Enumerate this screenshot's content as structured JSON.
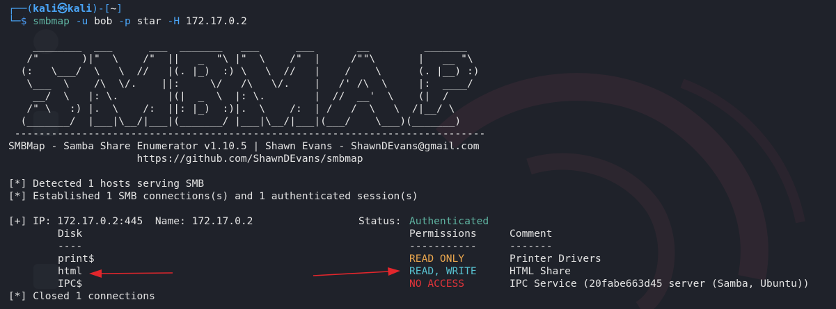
{
  "prompt": {
    "open": "┌──(",
    "user": "kali",
    "at": "㉿",
    "host": "kali",
    "close": ")-[",
    "dir": "~",
    "end": "]",
    "second": "└─",
    "dollar": "$",
    "command": "smbmap",
    "args": [
      {
        "flag": "-u",
        "value": "bob"
      },
      {
        "flag": "-p",
        "value": "star"
      },
      {
        "flag": "-H",
        "value": "172.17.0.2"
      }
    ]
  },
  "banner_lines": [
    "    ________  ___      ___  _______   ___      ___       __         _______",
    "   /\"       )|\"  \\    /\"  ||   _  \"\\ |\"  \\    /\"  |     /\"\"\\       |   __ \"\\",
    "  (:   \\___/  \\   \\  //   |(. |_)  :) \\   \\  //   |    /    \\      (. |__) :)",
    "   \\___  \\    /\\  \\/.    ||:     \\/   /\\   \\/.    |   /' /\\  \\     |:  ____/",
    "    __/  \\   |: \\.        |(|  _  \\  |: \\.        |  //  __'  \\    (|  /",
    "   /\" \\   :) |.  \\    /:  ||: |_)  :)|.  \\    /:  | /   /  \\   \\  /|__/ \\",
    "  (_______/  |___|\\__/|___|(_______/ |___|\\__/|___|(___/    \\___)(_______)",
    " -----------------------------------------------------------------------------"
  ],
  "header": {
    "title": "SMBMap - Samba Share Enumerator v1.10.5 | Shawn Evans - ShawnDEvans@gmail.com",
    "url": "                     https://github.com/ShawnDEvans/smbmap"
  },
  "status_lines": [
    "[*] Detected 1 hosts serving SMB",
    "[*] Established 1 SMB connections(s) and 1 authenticated session(s)"
  ],
  "host": {
    "prefix": "[+] IP: 172.17.0.2:445  Name: 172.17.0.2",
    "status_label": "Status: ",
    "status_value": "Authenticated"
  },
  "table": {
    "headers": {
      "disk": "Disk",
      "permissions": "Permissions",
      "comment": "Comment"
    },
    "underlines": {
      "disk": "----",
      "permissions": "-----------",
      "comment": "-------"
    },
    "rows": [
      {
        "disk": "print$",
        "permissions": "READ ONLY",
        "comment": "Printer Drivers"
      },
      {
        "disk": "html",
        "permissions": "READ, WRITE",
        "comment": "HTML Share"
      },
      {
        "disk": "IPC$",
        "permissions": "NO ACCESS",
        "comment": "IPC Service (20fabe663d45 server (Samba, Ubuntu))"
      }
    ]
  },
  "footer": "[*] Closed 1 connections",
  "colors": {
    "authenticated": "#5fb3a1",
    "read_only": "#e9a64e",
    "read_write": "#57c1d0",
    "no_access": "#e2343a",
    "arrow": "#e2262c"
  },
  "icons": [
    "dragon-wallpaper-icon",
    "arrow-left-icon",
    "arrow-right-icon"
  ]
}
